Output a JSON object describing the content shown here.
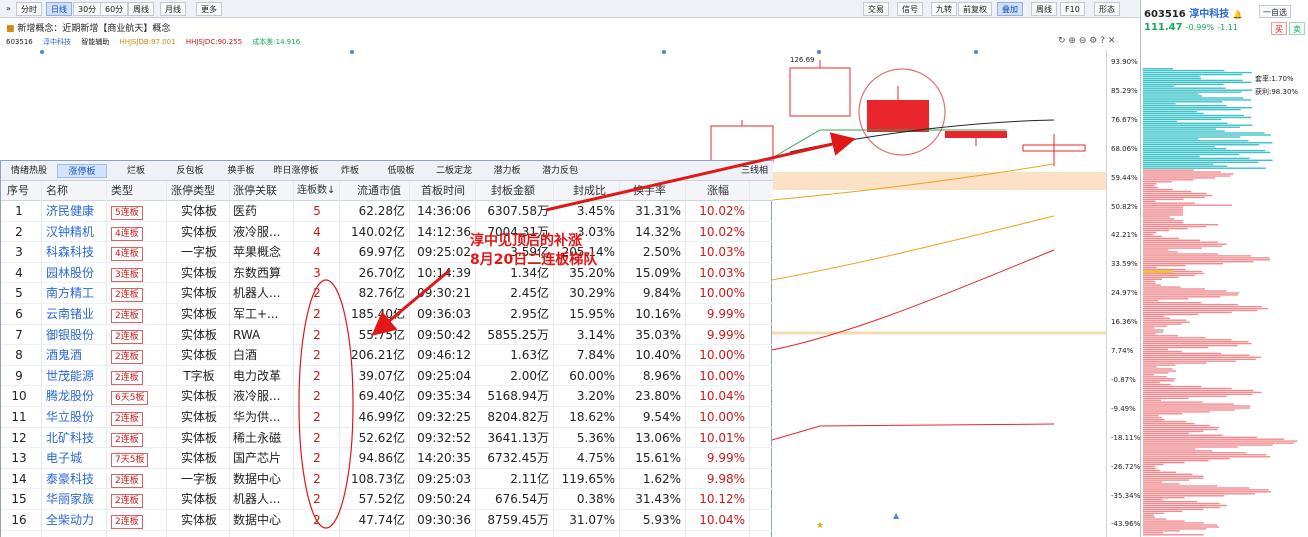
{
  "toolbar": {
    "left_buttons": [
      "分时",
      "日线",
      "30分",
      "60分",
      "周线",
      "月线",
      "更多"
    ],
    "active_left": 1,
    "right_buttons": [
      "交易",
      "信号",
      "九转",
      "前复权",
      "叠加",
      "周线",
      "F10",
      "形态"
    ],
    "active_right": 4
  },
  "concept_line": "新增概念：近期新增【商业航天】概念",
  "info_line": {
    "code": "603516",
    "name": "淳中科技",
    "items": [
      "智能辅助",
      "HHJSJDB:97.001",
      "HHJSJDC:90.255",
      "成本差:14.916"
    ]
  },
  "axis_ticks": [
    "93.90%",
    "85.29%",
    "76.67%",
    "68.06%",
    "59.44%",
    "50.82%",
    "42.21%",
    "33.59%",
    "24.97%",
    "16.36%",
    "7.74%",
    "-0.87%",
    "-9.49%",
    "-18.11%",
    "-26.72%",
    "-35.34%",
    "-43.96%"
  ],
  "chart_label_high": "126.69",
  "right_panel": {
    "code": "603516",
    "name": "淳中科技",
    "price": "111.47",
    "change_pct": "-0.99%",
    "change": "-1.11",
    "btn_self": "一自选",
    "btn_buy": "买",
    "btn_sell": "卖",
    "label_win": "套率:1.70%",
    "label_profit": "获利:98.30%"
  },
  "table": {
    "tabs": [
      "情绪热股",
      "涨停板",
      "烂板",
      "反包板",
      "换手板",
      "昨日涨停板",
      "炸板",
      "低吸板",
      "二板定龙",
      "潜力板",
      "潜力反包"
    ],
    "active_tab": 1,
    "tab_extra": "三线相",
    "headers": [
      "序号",
      "名称",
      "类型",
      "涨停类型",
      "涨停关联",
      "连板数↓",
      "流通市值",
      "首板时间",
      "封板金额",
      "封成比",
      "换手率",
      "涨幅"
    ],
    "rows": [
      [
        "1",
        "济民健康",
        "5连板",
        "实体板",
        "医药",
        "5",
        "62.28亿",
        "14:36:06",
        "6307.58万",
        "3.45%",
        "31.31%",
        "10.02%"
      ],
      [
        "2",
        "汉钟精机",
        "4连板",
        "实体板",
        "液冷服...",
        "4",
        "140.02亿",
        "14:12:36",
        "7004.31万",
        "3.03%",
        "14.32%",
        "10.02%"
      ],
      [
        "3",
        "科森科技",
        "4连板",
        "一字板",
        "苹果概念",
        "4",
        "69.97亿",
        "09:25:02",
        "3.59亿",
        "205.14%",
        "2.50%",
        "10.03%"
      ],
      [
        "4",
        "园林股份",
        "3连板",
        "实体板",
        "东数西算",
        "3",
        "26.70亿",
        "10:14:39",
        "1.34亿",
        "35.20%",
        "15.09%",
        "10.03%"
      ],
      [
        "5",
        "南方精工",
        "2连板",
        "实体板",
        "机器人...",
        "2",
        "82.76亿",
        "09:30:21",
        "2.45亿",
        "30.29%",
        "9.84%",
        "10.00%"
      ],
      [
        "6",
        "云南锗业",
        "2连板",
        "实体板",
        "军工+...",
        "2",
        "185.40亿",
        "09:36:03",
        "2.95亿",
        "15.95%",
        "10.16%",
        "9.99%"
      ],
      [
        "7",
        "御银股份",
        "2连板",
        "实体板",
        "RWA",
        "2",
        "55.75亿",
        "09:50:42",
        "5855.25万",
        "3.14%",
        "35.03%",
        "9.99%"
      ],
      [
        "8",
        "酒鬼酒",
        "2连板",
        "实体板",
        "白酒",
        "2",
        "206.21亿",
        "09:46:12",
        "1.63亿",
        "7.84%",
        "10.40%",
        "10.00%"
      ],
      [
        "9",
        "世茂能源",
        "2连板",
        "T字板",
        "电力改革",
        "2",
        "39.07亿",
        "09:25:04",
        "2.00亿",
        "60.00%",
        "8.96%",
        "10.00%"
      ],
      [
        "10",
        "腾龙股份",
        "6天5板",
        "实体板",
        "液冷服...",
        "2",
        "69.40亿",
        "09:35:34",
        "5168.94万",
        "3.20%",
        "23.80%",
        "10.04%"
      ],
      [
        "11",
        "华立股份",
        "2连板",
        "实体板",
        "华为供...",
        "2",
        "46.99亿",
        "09:32:25",
        "8204.82万",
        "18.62%",
        "9.54%",
        "10.00%"
      ],
      [
        "12",
        "北矿科技",
        "2连板",
        "实体板",
        "稀土永磁",
        "2",
        "52.62亿",
        "09:32:52",
        "3641.13万",
        "5.36%",
        "13.06%",
        "10.01%"
      ],
      [
        "13",
        "电子城",
        "7天5板",
        "实体板",
        "国产芯片",
        "2",
        "94.86亿",
        "14:20:35",
        "6732.45万",
        "4.75%",
        "15.61%",
        "9.99%"
      ],
      [
        "14",
        "泰豪科技",
        "2连板",
        "一字板",
        "数据中心",
        "2",
        "108.73亿",
        "09:25:03",
        "2.11亿",
        "119.65%",
        "1.62%",
        "9.98%"
      ],
      [
        "15",
        "华丽家族",
        "2连板",
        "实体板",
        "机器人...",
        "2",
        "57.52亿",
        "09:50:24",
        "676.54万",
        "0.38%",
        "31.43%",
        "10.12%"
      ],
      [
        "16",
        "全柴动力",
        "2连板",
        "实体板",
        "数据中心",
        "2",
        "47.74亿",
        "09:30:36",
        "8759.45万",
        "31.07%",
        "5.93%",
        "10.04%"
      ]
    ]
  },
  "annotation": {
    "line1": "淳中见顶后的补涨",
    "line2": "8月20日二连板梯队"
  },
  "colors": {
    "up": "#e8262b",
    "down": "#17a85e",
    "link": "#2a68d8",
    "cost_cyan": "#3cc3c8",
    "cost_red": "#f08b90"
  }
}
